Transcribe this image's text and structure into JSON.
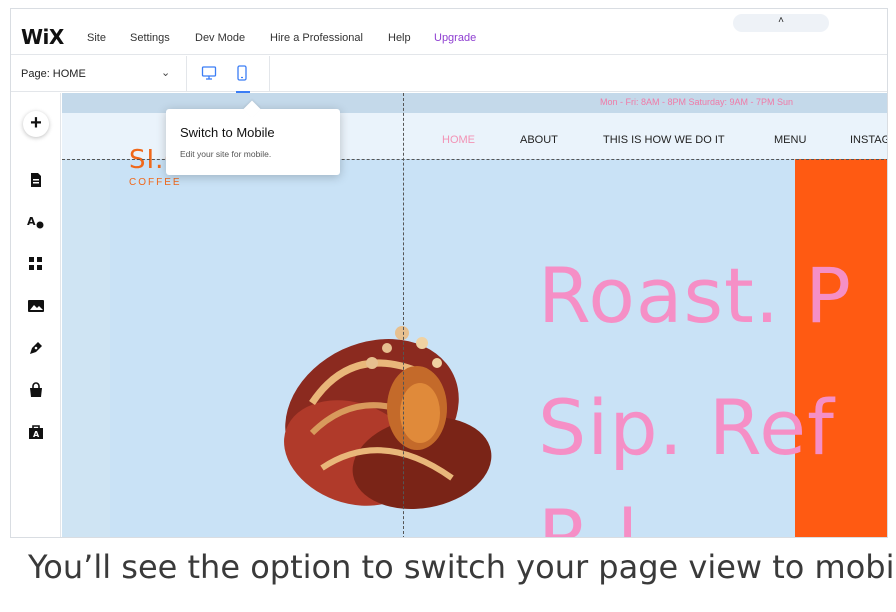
{
  "topbar": {
    "logo": "WiX",
    "menu": [
      "Site",
      "Settings",
      "Dev Mode",
      "Hire a Professional",
      "Help",
      "Upgrade"
    ],
    "pill_icon": "chevron-up-icon",
    "pill_text": "˄"
  },
  "subbar": {
    "page_label": "Page: HOME",
    "chevron": "⌄",
    "desktop_icon": "desktop-icon",
    "mobile_icon": "mobile-icon"
  },
  "leftbar": {
    "add_label": "+",
    "tools": [
      "pages-icon",
      "design-icon",
      "apps-icon",
      "media-icon",
      "blog-icon",
      "store-icon",
      "business-icon"
    ]
  },
  "tooltip": {
    "title": "Switch to Mobile",
    "subtitle": "Edit your site for mobile."
  },
  "site": {
    "hours": "Mon - Fri: 8AM - 8PM    Saturday: 9AM - 7PM    Sun",
    "nav": [
      "HOME",
      "ABOUT",
      "THIS IS HOW WE DO IT",
      "MENU",
      "INSTAG"
    ],
    "brand": "SI.C.S",
    "brand_sub": "COFFEE",
    "headline_1": "Roast. P",
    "headline_2": "Sip. Ref",
    "headline_3": "R          l",
    "colors": {
      "accent_pink": "#f58fc6",
      "accent_orange": "#ff5a12",
      "hero_bg": "#c9e2f6"
    }
  },
  "caption": "You’ll see the option to switch your page view to mobile"
}
